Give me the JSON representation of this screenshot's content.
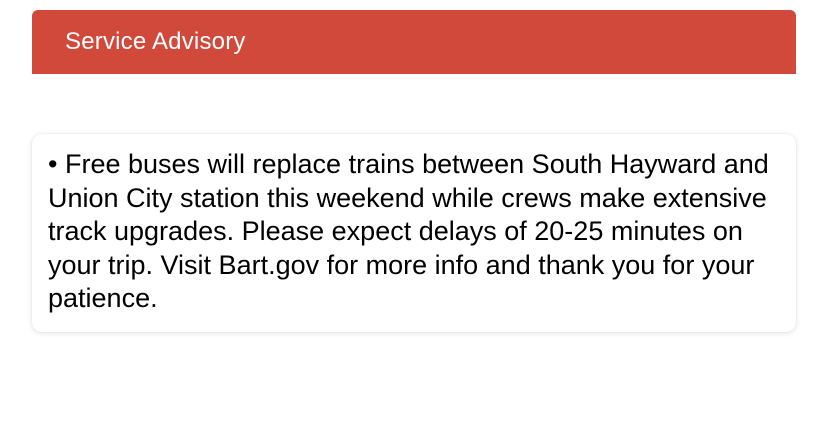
{
  "header": {
    "title": "Service Advisory",
    "color": "#d1493b"
  },
  "advisory": {
    "items": [
      "• Free buses will replace trains between South Hayward and Union City station this weekend while crews make extensive track upgrades. Please expect delays of 20-25 minutes on your trip. Visit Bart.gov for more info and thank you for your patience."
    ]
  }
}
